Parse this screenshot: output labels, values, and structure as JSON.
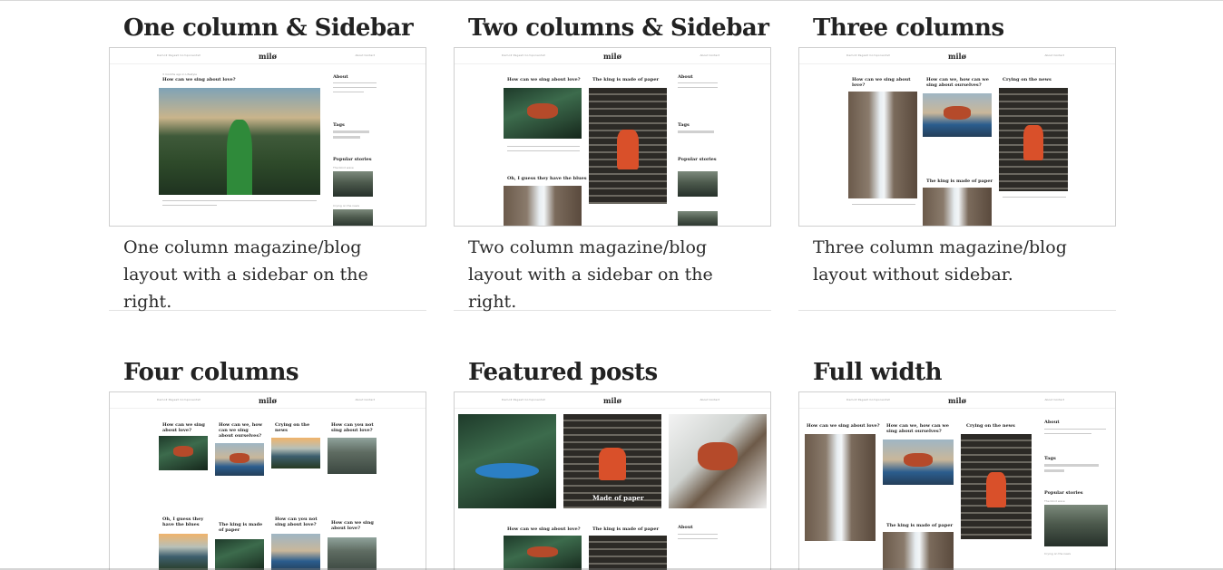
{
  "cards": [
    {
      "title": "One column & Sidebar",
      "description": "One column magazine/blog layout with a sidebar on the right.",
      "preview_logo": "milø"
    },
    {
      "title": "Two columns & Sidebar",
      "description": "Two column magazine/blog layout with a sidebar on the right.",
      "preview_logo": "milø"
    },
    {
      "title": "Three columns",
      "description": "Three column magazine/blog layout without sidebar.",
      "preview_logo": "milø"
    },
    {
      "title": "Four columns",
      "description": "",
      "preview_logo": "milø"
    },
    {
      "title": "Featured posts",
      "description": "",
      "preview_logo": "milø"
    },
    {
      "title": "Full width",
      "description": "",
      "preview_logo": "milø"
    }
  ],
  "preview_text": {
    "nav_left": "Demo▾  Pages▾  Components▾",
    "nav_right": "About  Contact",
    "post_1": "How can we sing about love?",
    "post_2": "The king is made of paper",
    "post_3": "Crying on the news",
    "post_4": "How can we, how can we sing about ourselves?",
    "post_5": "Oh, I guess they have the blues",
    "post_6": "How can you not sing about love?",
    "post_7": "How can we sing about love?",
    "meta": "3 months ago in Lifestyle",
    "about": "About",
    "tags": "Tags",
    "popular": "Popular stories",
    "popular_1": "The blind wave",
    "popular_2": "Crying on the news",
    "featured_caption": "Made of paper"
  }
}
